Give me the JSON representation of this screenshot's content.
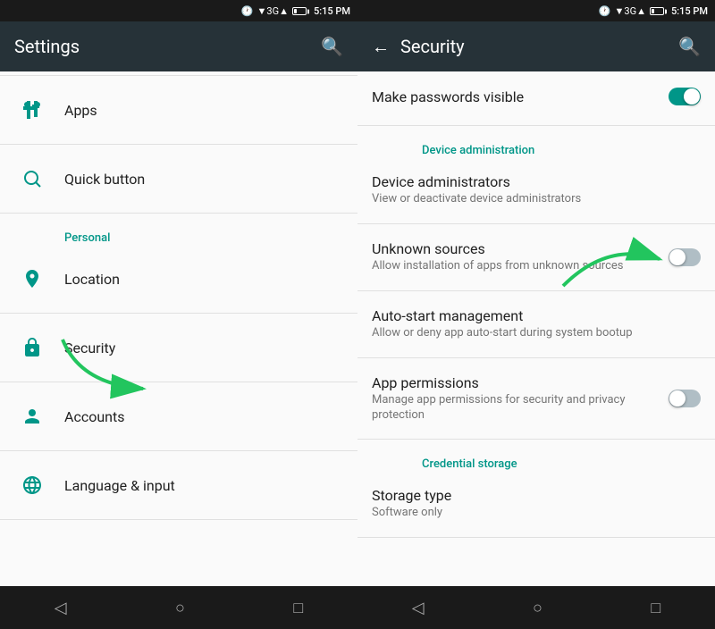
{
  "left": {
    "status": {
      "time": "5:15 PM",
      "signal": "3G",
      "battery": "25%"
    },
    "header": {
      "title": "Settings",
      "search_icon": "search"
    },
    "items": [
      {
        "id": "apps",
        "icon": "android",
        "label": "Apps",
        "subtitle": ""
      },
      {
        "id": "quick-button",
        "icon": "search",
        "label": "Quick button",
        "subtitle": ""
      }
    ],
    "section_personal": "Personal",
    "personal_items": [
      {
        "id": "location",
        "icon": "location",
        "label": "Location",
        "subtitle": ""
      },
      {
        "id": "security",
        "icon": "lock",
        "label": "Security",
        "subtitle": ""
      },
      {
        "id": "accounts",
        "icon": "person",
        "label": "Accounts",
        "subtitle": ""
      },
      {
        "id": "language",
        "icon": "globe",
        "label": "Language & input",
        "subtitle": ""
      }
    ],
    "nav": [
      "◁",
      "○",
      "□"
    ]
  },
  "right": {
    "status": {
      "time": "5:15 PM",
      "signal": "3G",
      "battery": "25%"
    },
    "header": {
      "title": "Security",
      "back_icon": "←",
      "search_icon": "search"
    },
    "items": [
      {
        "id": "make-passwords",
        "label": "Make passwords visible",
        "subtitle": "",
        "toggle": true,
        "toggle_state": "on"
      }
    ],
    "section_device_admin": "Device administration",
    "device_admin_items": [
      {
        "id": "device-administrators",
        "label": "Device administrators",
        "subtitle": "View or deactivate device administrators",
        "toggle": false
      },
      {
        "id": "unknown-sources",
        "label": "Unknown sources",
        "subtitle": "Allow installation of apps from unknown sources",
        "toggle": true,
        "toggle_state": "off"
      },
      {
        "id": "auto-start",
        "label": "Auto-start management",
        "subtitle": "Allow or deny app auto-start during system bootup",
        "toggle": false
      },
      {
        "id": "app-permissions",
        "label": "App permissions",
        "subtitle": "Manage app permissions for security and privacy protection",
        "toggle": true,
        "toggle_state": "off"
      }
    ],
    "section_credential": "Credential storage",
    "credential_items": [
      {
        "id": "storage-type",
        "label": "Storage type",
        "subtitle": "Software only",
        "toggle": false
      }
    ],
    "nav": [
      "◁",
      "○",
      "□"
    ]
  }
}
